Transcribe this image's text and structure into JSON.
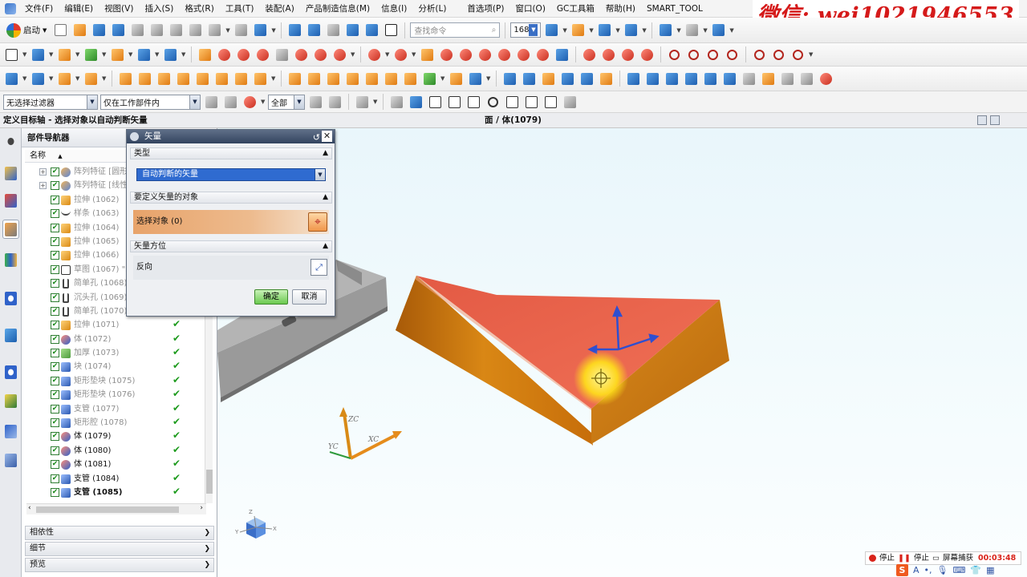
{
  "menubar": {
    "items": [
      "文件(F)",
      "编辑(E)",
      "视图(V)",
      "插入(S)",
      "格式(R)",
      "工具(T)",
      "装配(A)",
      "产品制造信息(M)",
      "信息(I)",
      "分析(L)",
      "首选项(P)",
      "窗口(O)",
      "GC工具箱",
      "帮助(H)",
      "SMART_TOOL"
    ]
  },
  "watermark": "微信: wei1021946553",
  "toolbar": {
    "start_label": "启动",
    "search_placeholder": "查找命令",
    "zoom_value": "168"
  },
  "selection_bar": {
    "filter_value": "无选择过滤器",
    "scope_value": "仅在工作部件内",
    "assembly_value": "全部"
  },
  "prompt": {
    "cue": "定义目标轴 - 选择对象以自动判断矢量",
    "status": "面 / 体(1079)"
  },
  "navigator": {
    "title": "部件导航器",
    "column_name": "名称",
    "rows": [
      {
        "label": "阵列特征 [圆形]",
        "icon": "pattern",
        "expander": true,
        "dim": true,
        "check": false
      },
      {
        "label": "阵列特征 [线性]",
        "icon": "pattern",
        "expander": true,
        "dim": true,
        "check": false
      },
      {
        "label": "拉伸 (1062)",
        "icon": "extrude",
        "dim": true,
        "check": false
      },
      {
        "label": "样条 (1063)",
        "icon": "spline",
        "dim": true,
        "check": false
      },
      {
        "label": "拉伸 (1064)",
        "icon": "extrude",
        "dim": true,
        "check": false
      },
      {
        "label": "拉伸 (1065)",
        "icon": "extrude",
        "dim": true,
        "check": false
      },
      {
        "label": "拉伸 (1066)",
        "icon": "extrude",
        "dim": true,
        "check": false
      },
      {
        "label": "草图 (1067) \"SK",
        "icon": "sketch",
        "dim": true,
        "check": false
      },
      {
        "label": "简单孔 (1068)",
        "icon": "hole",
        "dim": true,
        "check": false
      },
      {
        "label": "沉头孔 (1069)",
        "icon": "hole",
        "dim": true,
        "check": false
      },
      {
        "label": "简单孔 (1070)",
        "icon": "hole",
        "dim": true,
        "check": false
      },
      {
        "label": "拉伸 (1071)",
        "icon": "extrude",
        "dim": true,
        "check": true
      },
      {
        "label": "体 (1072)",
        "icon": "body",
        "dim": true,
        "check": true
      },
      {
        "label": "加厚 (1073)",
        "icon": "thicken",
        "dim": true,
        "check": true
      },
      {
        "label": "块 (1074)",
        "icon": "block",
        "dim": true,
        "check": true
      },
      {
        "label": "矩形垫块 (1075)",
        "icon": "block",
        "dim": true,
        "check": true
      },
      {
        "label": "矩形垫块 (1076)",
        "icon": "block",
        "dim": true,
        "check": true
      },
      {
        "label": "支管 (1077)",
        "icon": "block",
        "dim": true,
        "check": true
      },
      {
        "label": "矩形腔 (1078)",
        "icon": "block",
        "dim": true,
        "check": true
      },
      {
        "label": "体 (1079)",
        "icon": "body",
        "dim": false,
        "check": true
      },
      {
        "label": "体 (1080)",
        "icon": "body",
        "dim": false,
        "check": true
      },
      {
        "label": "体 (1081)",
        "icon": "body",
        "dim": false,
        "check": true
      },
      {
        "label": "支管 (1084)",
        "icon": "block",
        "dim": false,
        "check": true
      },
      {
        "label": "支管 (1085)",
        "icon": "block",
        "dim": false,
        "bold": true,
        "check": true
      }
    ],
    "panels": [
      "相依性",
      "细节",
      "预览"
    ]
  },
  "dialog": {
    "title": "矢量",
    "section_type": "类型",
    "type_value": "自动判断的矢量",
    "section_object": "要定义矢量的对象",
    "select_object_label": "选择对象 (0)",
    "section_orientation": "矢量方位",
    "reverse_label": "反向",
    "ok_label": "确定",
    "cancel_label": "取消"
  },
  "viewport": {
    "csys_labels": [
      "ZC",
      "YC",
      "XC"
    ],
    "view_triad_labels": [
      "Z",
      "Y",
      "X"
    ],
    "colors": {
      "top_face": "#e9624b",
      "side_face": "#cf7a12",
      "base_gray": "#8b8b8b",
      "cursor_glow": "#ffe21a"
    }
  },
  "recorder": {
    "stop_label": "停止",
    "pause_label": "停止",
    "capture_label": "屏幕捕获",
    "time": "00:03:48"
  },
  "ime": {
    "logo": "S",
    "mode": "A"
  }
}
